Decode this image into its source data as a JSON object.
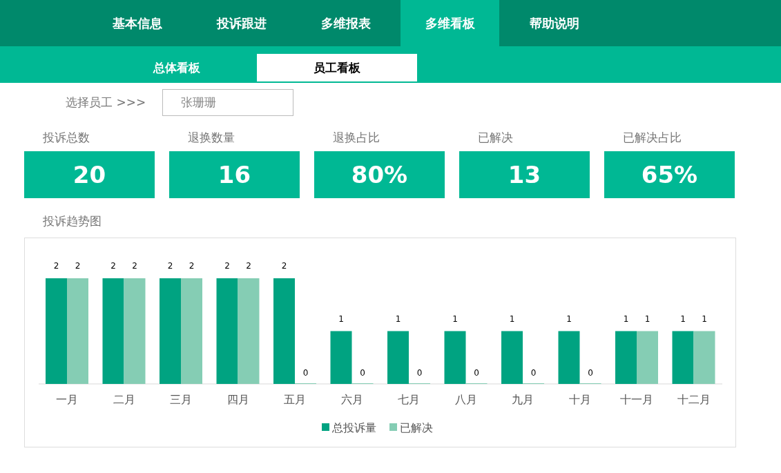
{
  "nav": [
    {
      "label": "基本信息",
      "selected": false
    },
    {
      "label": "投诉跟进",
      "selected": false
    },
    {
      "label": "多维报表",
      "selected": false
    },
    {
      "label": "多维看板",
      "selected": true
    },
    {
      "label": "帮助说明",
      "selected": false
    }
  ],
  "subtabs": [
    {
      "label": "总体看板",
      "selected": false
    },
    {
      "label": "员工看板",
      "selected": true
    }
  ],
  "selector": {
    "label": "选择员工 >>>",
    "value": "张珊珊"
  },
  "kpis": [
    {
      "label": "投诉总数",
      "value": "20"
    },
    {
      "label": "退换数量",
      "value": "16"
    },
    {
      "label": "退换占比",
      "value": "80%"
    },
    {
      "label": "已解决",
      "value": "13"
    },
    {
      "label": "已解决占比",
      "value": "65%"
    }
  ],
  "chart": {
    "title": "投诉趋势图",
    "chart_data": {
      "type": "bar",
      "legend": true,
      "categories": [
        "一月",
        "二月",
        "三月",
        "四月",
        "五月",
        "六月",
        "七月",
        "八月",
        "九月",
        "十月",
        "十一月",
        "十二月"
      ],
      "data_labels": true,
      "series": [
        {
          "name": "总投诉量",
          "color": "#00a381",
          "values": [
            2,
            2,
            2,
            2,
            2,
            1,
            1,
            1,
            1,
            1,
            1,
            1
          ]
        },
        {
          "name": "已解决",
          "color": "#85cdb4",
          "values": [
            2,
            2,
            2,
            2,
            0,
            0,
            0,
            0,
            0,
            0,
            1,
            1
          ]
        }
      ]
    }
  }
}
